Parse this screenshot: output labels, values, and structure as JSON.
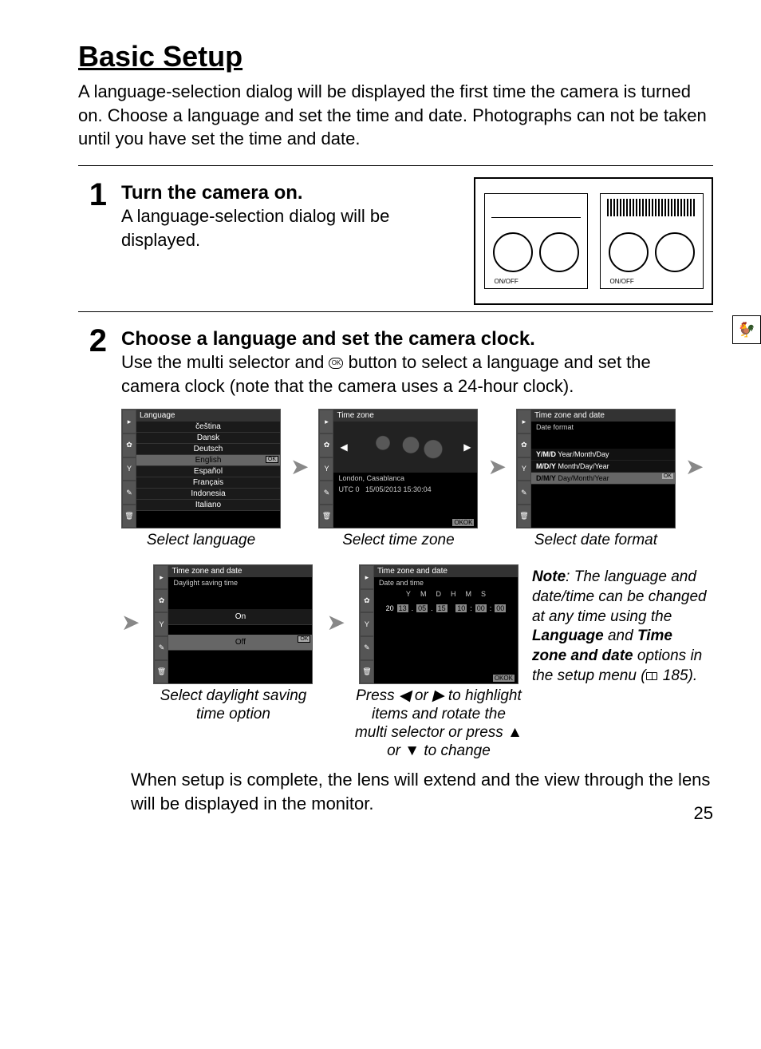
{
  "title": "Basic Setup",
  "intro": "A language-selection dialog will be displayed the first time the camera is turned on. Choose a language and set the time and date. Photographs can not be taken until you have set the time and date.",
  "steps": {
    "s1": {
      "num": "1",
      "head": "Turn the camera on.",
      "body": "A language-selection dialog will be displayed."
    },
    "s2": {
      "num": "2",
      "head": "Choose a language and set the camera clock.",
      "body_a": "Use the multi selector and ",
      "body_b": " button to select a language and set the camera clock (note that the camera uses a 24-hour clock)."
    }
  },
  "camera_label": "ON/OFF",
  "ok_label": "OK",
  "screens": {
    "lang": {
      "title": "Language",
      "items": [
        "čeština",
        "Dansk",
        "Deutsch",
        "English",
        "Español",
        "Français",
        "Indonesia",
        "Italiano"
      ],
      "selected_index": 3,
      "caption": "Select language"
    },
    "tz": {
      "title": "Time zone",
      "city": "London, Casablanca",
      "utc": "UTC 0",
      "datetime": "15/05/2013 15:30:04",
      "ok": "OK",
      "caption": "Select time zone"
    },
    "fmt": {
      "title": "Time zone and date",
      "sub": "Date format",
      "options": [
        {
          "code": "Y/M/D",
          "label": "Year/Month/Day"
        },
        {
          "code": "M/D/Y",
          "label": "Month/Day/Year"
        },
        {
          "code": "D/M/Y",
          "label": "Day/Month/Year"
        }
      ],
      "selected_index": 2,
      "caption": "Select date format"
    },
    "dst": {
      "title": "Time zone and date",
      "sub": "Daylight saving time",
      "options": [
        "On",
        "Off"
      ],
      "selected_index": 1,
      "caption": "Select daylight saving time option"
    },
    "dt": {
      "title": "Time zone and date",
      "sub": "Date and time",
      "labels": [
        "Y",
        "M",
        "D",
        "H",
        "M",
        "S"
      ],
      "year_pref": "20",
      "values": [
        "13",
        "05",
        "15",
        "10",
        "00",
        "00"
      ],
      "ok": "OK",
      "caption": "Press ◀ or ▶ to highlight items and rotate the multi selector or press ▲ or ▼ to change"
    }
  },
  "note": {
    "lead": "Note",
    "text_a": ": The language and date/time can be changed at any time using the ",
    "lang": "Language",
    "and": " and ",
    "tzd": "Time zone and date",
    "text_b": " options in the setup menu (",
    "pgref": " 185)."
  },
  "closing": "When setup is complete, the lens will extend and the view through the lens will be displayed in the monitor.",
  "page_number": "25"
}
